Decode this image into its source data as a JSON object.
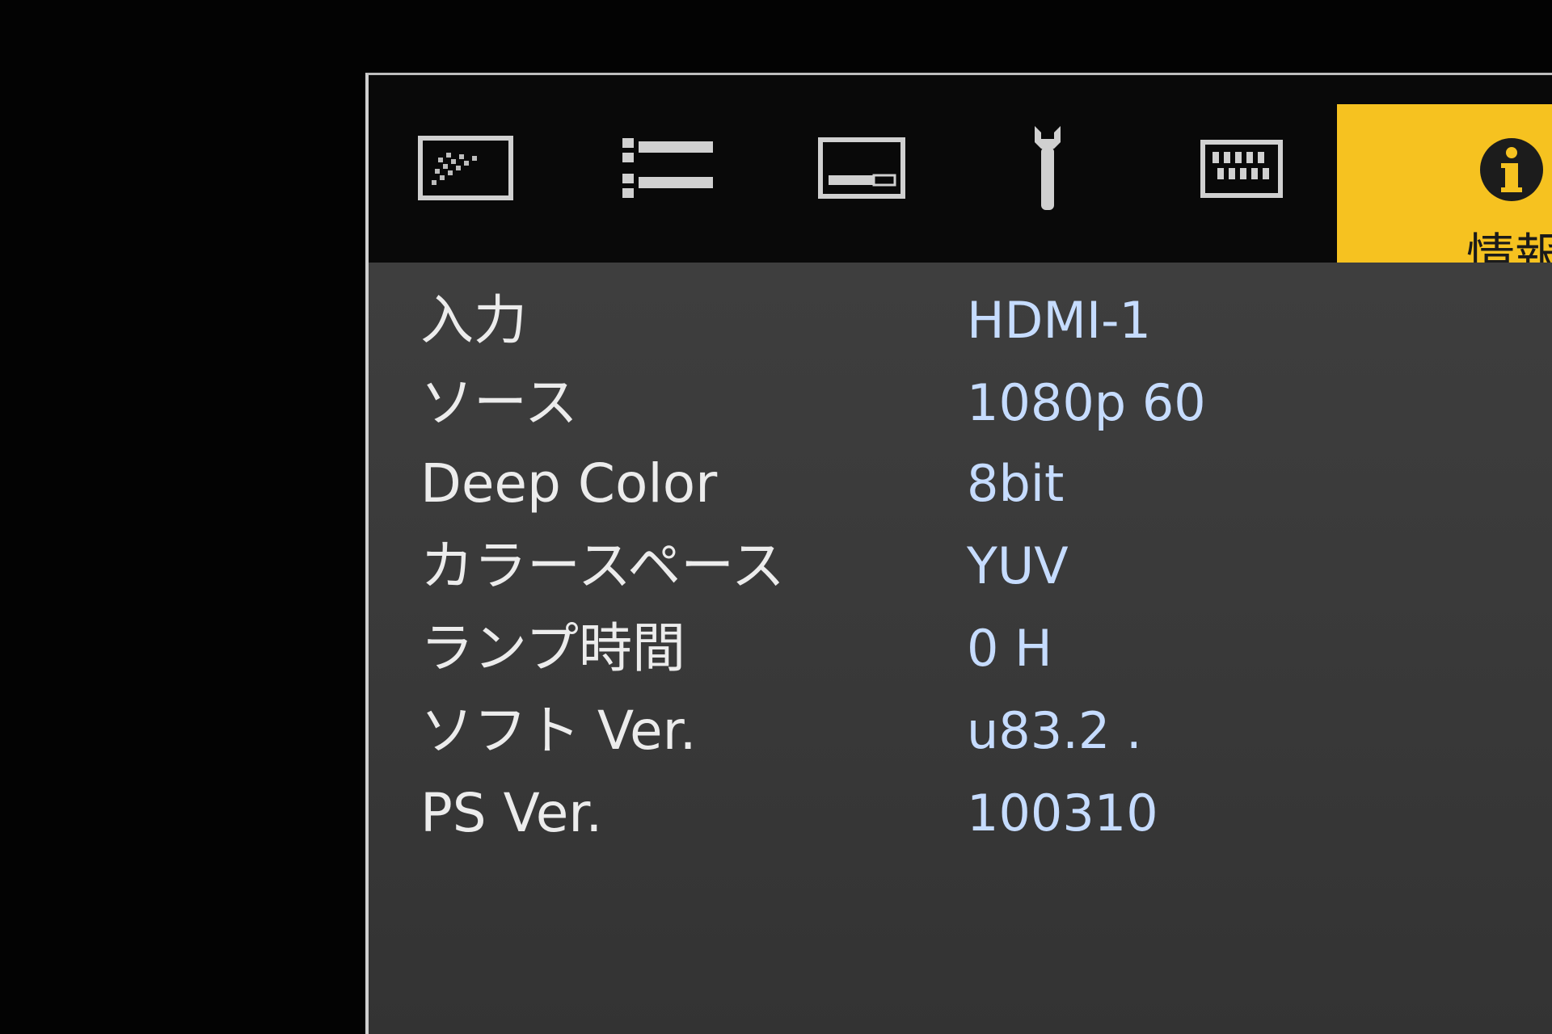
{
  "tabs": [
    {
      "icon": "picture-quality-icon",
      "active": false
    },
    {
      "icon": "input-settings-icon",
      "active": false
    },
    {
      "icon": "display-screen-icon",
      "active": false
    },
    {
      "icon": "wrench-setup-icon",
      "active": false
    },
    {
      "icon": "pattern-grid-icon",
      "active": false
    },
    {
      "icon": "info-icon",
      "active": true,
      "label": "情報"
    }
  ],
  "info": {
    "rows": [
      {
        "label": "入力",
        "value": "HDMI-1"
      },
      {
        "label": "ソース",
        "value": "1080p 60"
      },
      {
        "label": "Deep Color",
        "value": "8bit"
      },
      {
        "label": "カラースペース",
        "value": "YUV"
      },
      {
        "label": "ランプ時間",
        "value": "0 H"
      },
      {
        "label": "ソフト Ver.",
        "value": "u83.2 ."
      },
      {
        "label": "PS Ver.",
        "value": "100310"
      }
    ]
  },
  "colors": {
    "active_tab": "#f6c220",
    "label_text": "#ececec",
    "value_text": "#c6dcff",
    "panel_bg": "#3a3a3a",
    "tabbar_bg": "#090909"
  }
}
